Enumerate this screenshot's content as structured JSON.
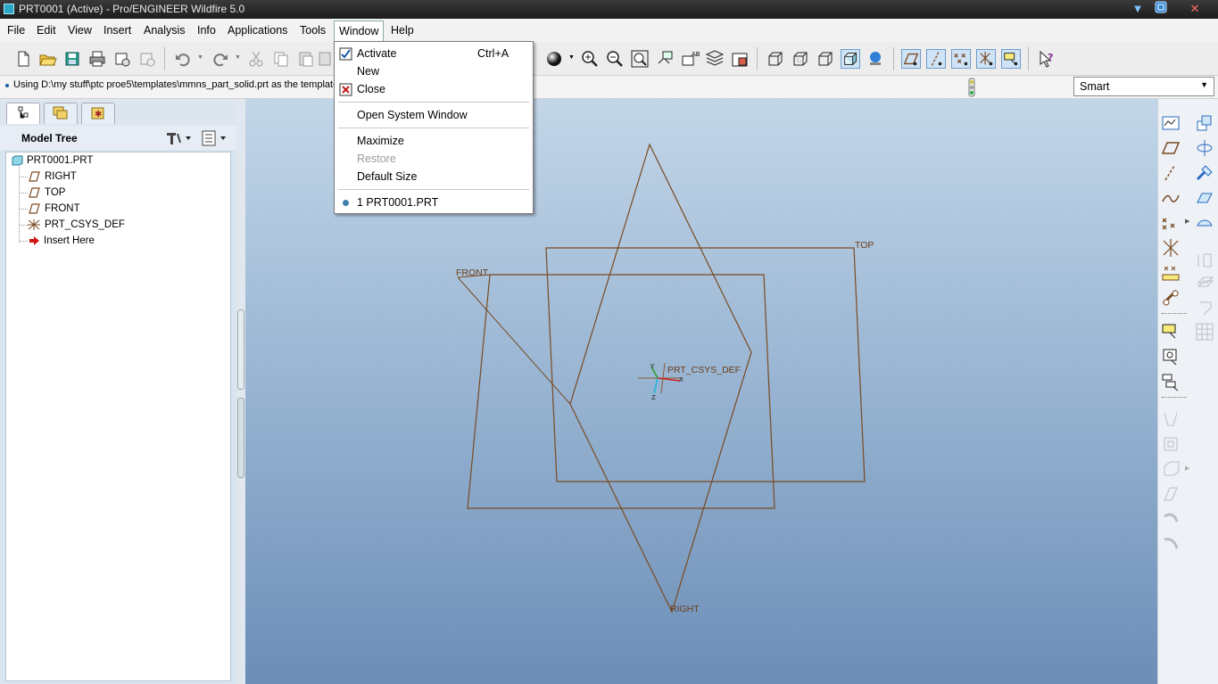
{
  "window": {
    "title": "PRT0001 (Active) - Pro/ENGINEER Wildfire 5.0"
  },
  "menubar": {
    "items": [
      "File",
      "Edit",
      "View",
      "Insert",
      "Analysis",
      "Info",
      "Applications",
      "Tools",
      "Window",
      "Help"
    ],
    "open_menu": "Window"
  },
  "window_menu": {
    "activate": {
      "label": "Activate",
      "shortcut": "Ctrl+A"
    },
    "new": {
      "label": "New"
    },
    "close": {
      "label": "Close"
    },
    "open_system_window": {
      "label": "Open System Window"
    },
    "maximize": {
      "label": "Maximize"
    },
    "restore": {
      "label": "Restore",
      "disabled": true
    },
    "default_size": {
      "label": "Default Size"
    },
    "window_list": [
      {
        "label": "1 PRT0001.PRT"
      }
    ]
  },
  "message": {
    "text": "Using D:\\my stuff\\ptc proe5\\templates\\mmns_part_solid.prt as the template"
  },
  "filter": {
    "selected": "Smart"
  },
  "navigator": {
    "panel_title": "Model Tree"
  },
  "model_tree": {
    "root": "PRT0001.PRT",
    "items": [
      "RIGHT",
      "TOP",
      "FRONT",
      "PRT_CSYS_DEF",
      "Insert Here"
    ]
  },
  "graphics": {
    "datum_color": "#7a4a22",
    "labels": {
      "front": "FRONT",
      "top": "TOP",
      "right": "RIGHT",
      "csys": "PRT_CSYS_DEF",
      "axis_x": "X",
      "axis_y": "Y",
      "axis_z": "Z"
    }
  },
  "colors": {
    "accent": "#1f5ea8",
    "viewport_top": "#c3d6e8",
    "viewport_bottom": "#6c8eb7"
  }
}
